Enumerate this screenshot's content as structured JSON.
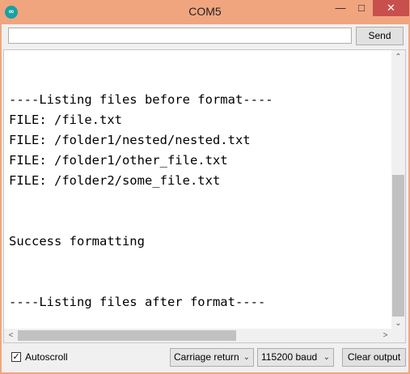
{
  "window": {
    "title": "COM5",
    "app_icon_glyph": "∞",
    "minimize_glyph": "—",
    "maximize_glyph": "□",
    "close_glyph": "✕"
  },
  "send_bar": {
    "input_value": "",
    "send_label": "Send"
  },
  "output": {
    "lines": [
      "----Listing files before format----",
      "FILE: /file.txt",
      "FILE: /folder1/nested/nested.txt",
      "FILE: /folder1/other_file.txt",
      "FILE: /folder2/some_file.txt",
      "",
      "",
      "Success formatting",
      "",
      "",
      "----Listing files after format----"
    ]
  },
  "scrollbar": {
    "up_glyph": "⌃",
    "down_glyph": "⌄",
    "left_glyph": "<",
    "right_glyph": ">"
  },
  "bottom_bar": {
    "autoscroll_label": "Autoscroll",
    "autoscroll_checked_glyph": "✓",
    "line_ending_value": "Carriage return",
    "baud_value": "115200 baud",
    "dropdown_glyph": "⌄",
    "clear_label": "Clear output"
  }
}
